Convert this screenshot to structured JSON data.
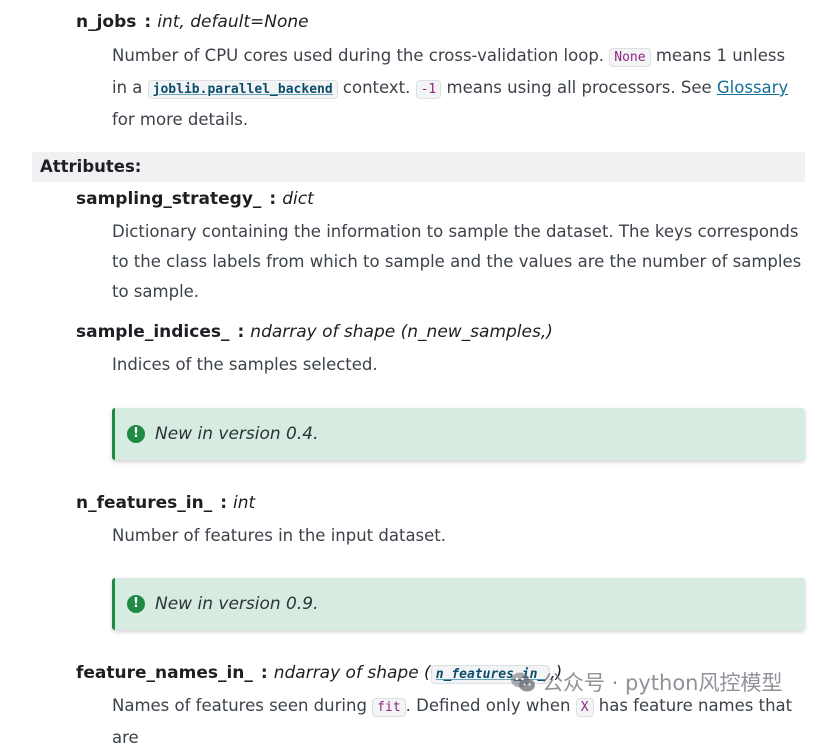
{
  "n_jobs": {
    "name": "n_jobs",
    "separator": ":",
    "type": "int, default=None",
    "desc": {
      "t1": "Number of CPU cores used during the cross-validation loop. ",
      "code_none": "None",
      "t2": " means 1 unless in a ",
      "code_backend": "joblib.parallel_backend",
      "t3": " context. ",
      "code_minus1": "-1",
      "t4": " means using all processors. See ",
      "link_glossary": "Glossary",
      "t5": " for more details."
    }
  },
  "attributes": {
    "header": "Attributes:",
    "sampling_strategy": {
      "name": "sampling_strategy_",
      "separator": ":",
      "type": "dict",
      "desc": "Dictionary containing the information to sample the dataset. The keys corresponds to the class labels from which to sample and the values are the number of samples to sample."
    },
    "sample_indices": {
      "name": "sample_indices_",
      "separator": ":",
      "type": "ndarray of shape (n_new_samples,)",
      "desc": "Indices of the samples selected.",
      "note": "New in version 0.4."
    },
    "n_features_in": {
      "name": "n_features_in_",
      "separator": ":",
      "type": "int",
      "desc": "Number of features in the input dataset.",
      "note": "New in version 0.9."
    },
    "feature_names_in": {
      "name": "feature_names_in_",
      "separator": ":",
      "type_prefix": "ndarray of shape (",
      "type_code": "n_features_in_",
      "type_suffix": ",)",
      "desc": {
        "t1": "Names of features seen during ",
        "code_fit": "fit",
        "t2": ". Defined only when ",
        "code_x": "X",
        "t3": " has feature names that are"
      }
    }
  },
  "icons": {
    "note_icon": "info-circle-icon",
    "note_icon_glyph": "!",
    "watermark_icon": "wechat-icon"
  },
  "watermark": {
    "text": "公众号 · python风控模型"
  },
  "colors": {
    "note_bg": "#d6ece1",
    "note_accent": "#1f8a44",
    "header_bg": "#eff1f3",
    "link": "#14709a",
    "code_text": "#912583"
  }
}
